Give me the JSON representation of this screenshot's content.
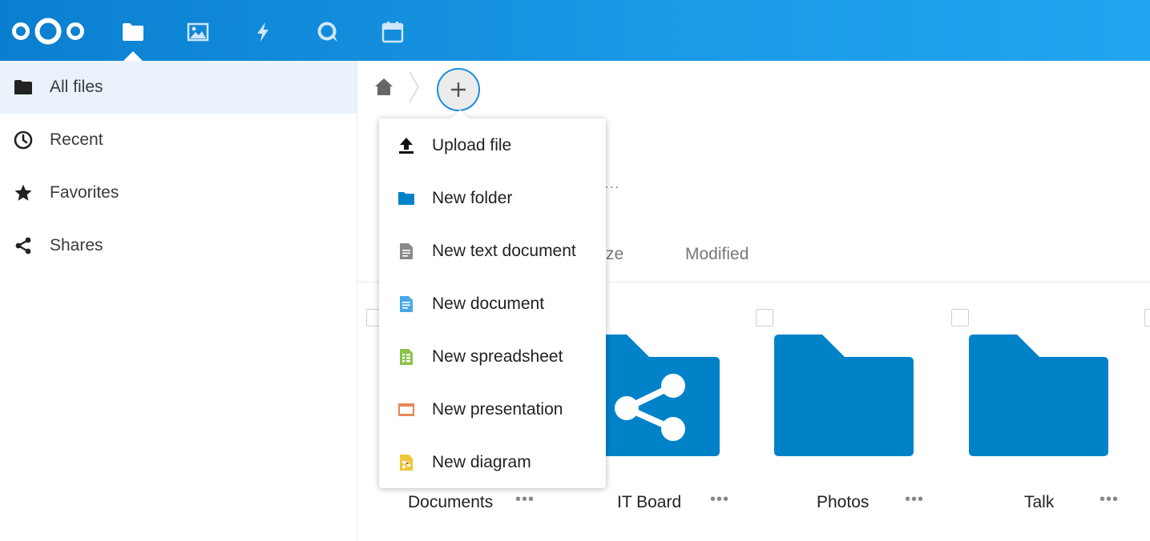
{
  "header": {
    "apps": [
      {
        "name": "files",
        "icon": "folder-icon"
      },
      {
        "name": "photos",
        "icon": "image-icon"
      },
      {
        "name": "activity",
        "icon": "lightning-icon"
      },
      {
        "name": "talk",
        "icon": "talk-icon"
      },
      {
        "name": "calendar",
        "icon": "calendar-icon"
      }
    ],
    "colors": {
      "gradient_start": "#0a7fd0",
      "gradient_end": "#22a5f0"
    }
  },
  "sidebar": {
    "items": [
      {
        "label": "All files",
        "icon": "folder-icon",
        "active": true
      },
      {
        "label": "Recent",
        "icon": "clock-icon"
      },
      {
        "label": "Favorites",
        "icon": "star-icon"
      },
      {
        "label": "Shares",
        "icon": "share-icon"
      }
    ]
  },
  "breadcrumb": {
    "home_icon": "home-icon",
    "new_icon": "plus-icon"
  },
  "list_header": {
    "truncated_dots": "...",
    "size_partial": "ze",
    "modified": "Modified"
  },
  "new_menu": {
    "items": [
      {
        "label": "Upload file",
        "icon": "upload-icon",
        "color": "#111111"
      },
      {
        "label": "New folder",
        "icon": "folder-icon",
        "color": "#0082c9"
      },
      {
        "label": "New text document",
        "icon": "text-document-icon",
        "color": "#8a8a8a"
      },
      {
        "label": "New document",
        "icon": "document-icon",
        "color": "#49a6e9"
      },
      {
        "label": "New spreadsheet",
        "icon": "spreadsheet-icon",
        "color": "#8bc34a"
      },
      {
        "label": "New presentation",
        "icon": "presentation-icon",
        "color": "#e8875a"
      },
      {
        "label": "New diagram",
        "icon": "diagram-icon",
        "color": "#f0c43c"
      }
    ]
  },
  "files": [
    {
      "name": "Documents",
      "type": "folder",
      "more": "•••"
    },
    {
      "name": "IT Board",
      "type": "shared-folder",
      "more": "•••"
    },
    {
      "name": "Photos",
      "type": "folder",
      "more": "•••"
    },
    {
      "name": "Talk",
      "type": "folder",
      "more": "•••"
    }
  ],
  "colors": {
    "folder": "#0082c9",
    "accent": "#1a8fdd",
    "active_bg": "#eaf3fc"
  }
}
